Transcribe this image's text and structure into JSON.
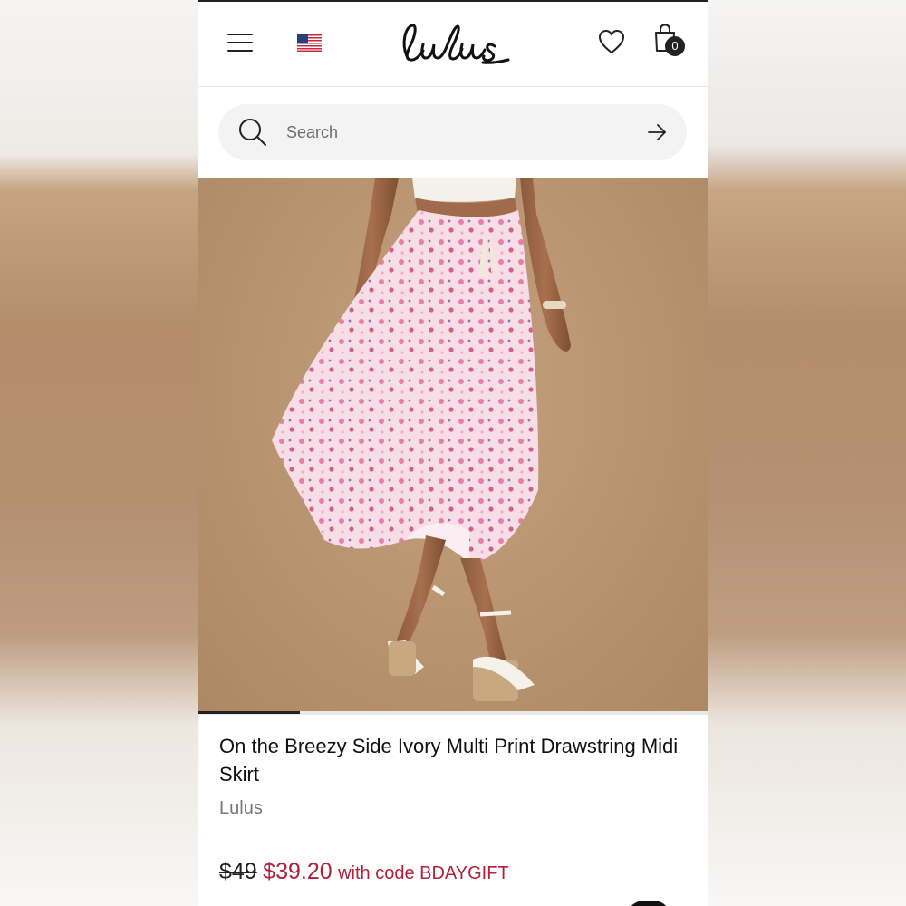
{
  "header": {
    "brand_logo": "Lulus",
    "cart_count": "0",
    "region_flag": "us-flag-icon",
    "icons": [
      "menu-icon",
      "heart-icon",
      "shopping-bag-icon"
    ]
  },
  "search": {
    "placeholder": "Search",
    "value": ""
  },
  "carousel": {
    "current_progress_fraction": 0.2
  },
  "product": {
    "title": "On the Breezy Side Ivory Multi Print Drawstring Midi Skirt",
    "brand": "Lulus",
    "original_price": "$49",
    "sale_price": "$39.20",
    "promo_text": "with code BDAYGIFT"
  },
  "colors": {
    "accent_sale": "#b3203c",
    "text_primary": "#111111",
    "text_muted": "#777777",
    "image_background": "#b8936f"
  }
}
